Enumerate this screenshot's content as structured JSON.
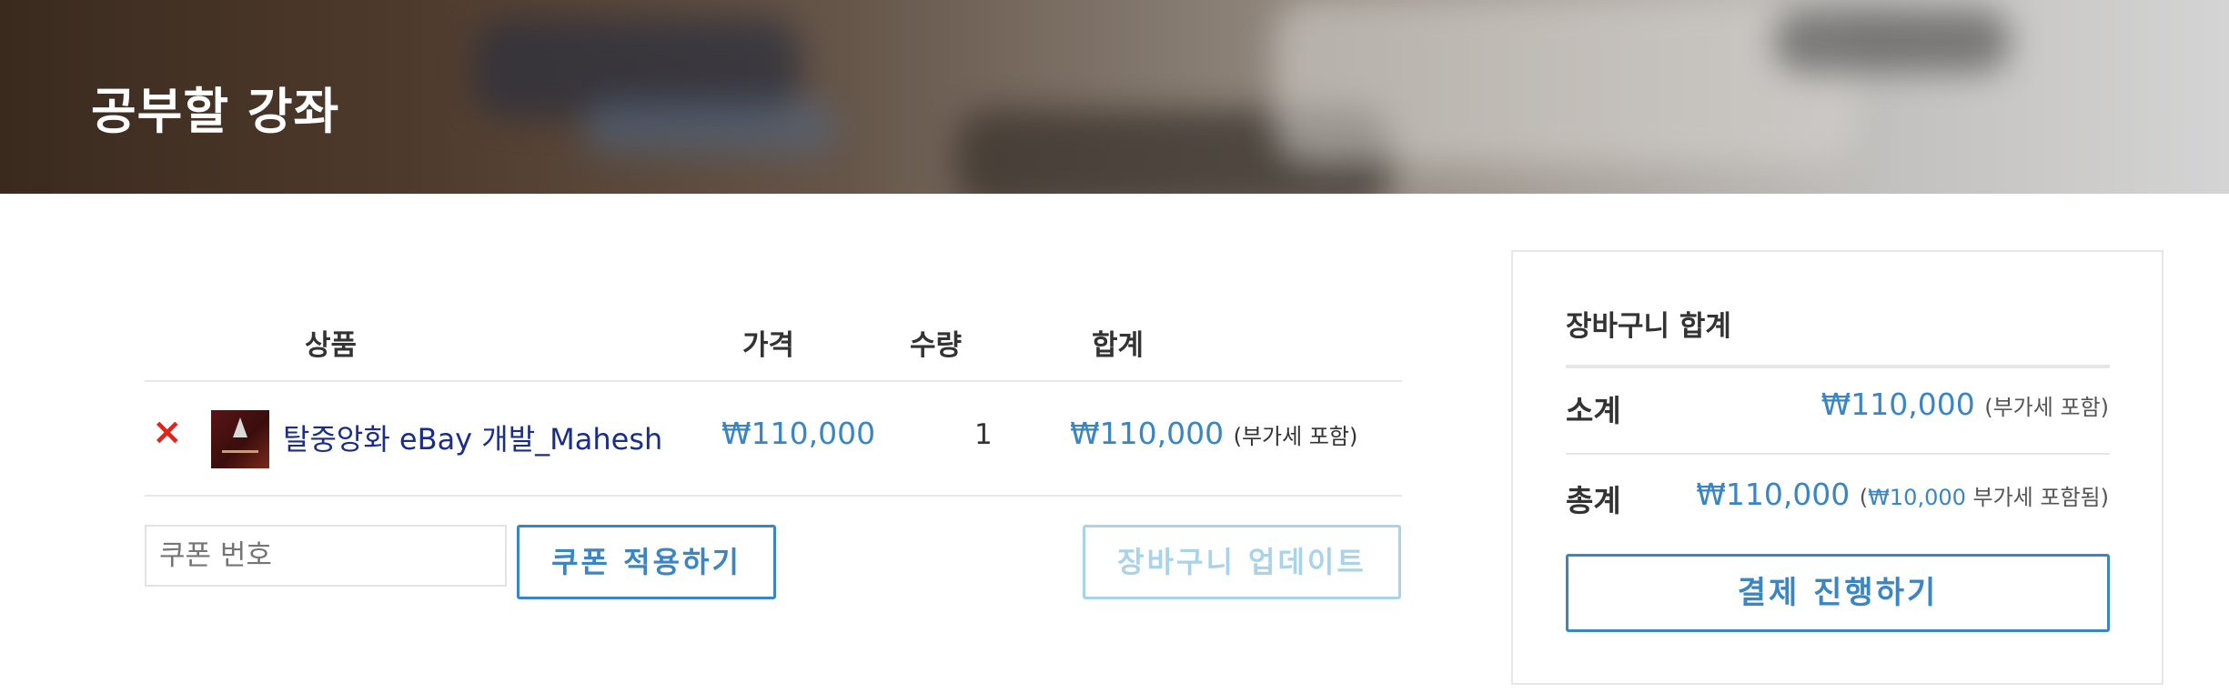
{
  "hero": {
    "title": "공부할 강좌"
  },
  "cart": {
    "headers": {
      "product": "상품",
      "price": "가격",
      "quantity": "수량",
      "subtotal": "합계"
    },
    "items": [
      {
        "remove_icon": "×",
        "product_name": "탈중앙화 eBay 개발_Mahesh",
        "price": "₩110,000",
        "quantity": "1",
        "subtotal": "₩110,000",
        "subtotal_note": "(부가세 포함)"
      }
    ],
    "coupon": {
      "placeholder": "쿠폰 번호",
      "apply_label": "쿠폰 적용하기"
    },
    "update_label": "장바구니 업데이트"
  },
  "totals": {
    "title": "장바구니 합계",
    "subtotal_label": "소계",
    "subtotal_value": "₩110,000",
    "subtotal_note": "(부가세 포함)",
    "total_label": "총계",
    "total_value": "₩110,000",
    "total_note_open": "(",
    "total_tax": "₩10,000",
    "total_note_close": " 부가세 포함됨)",
    "checkout_label": "결제 진행하기"
  },
  "colors": {
    "accent": "#3a86c4",
    "remove": "#e0261a",
    "product_link": "#1a2d8a",
    "disabled": "#a9d3ea"
  },
  "icons": {
    "remove": "close-icon",
    "thumbnail": "product-thumbnail"
  }
}
